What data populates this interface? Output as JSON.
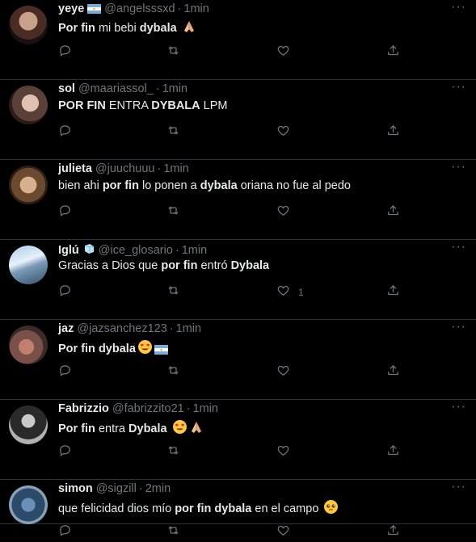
{
  "colors": {
    "background": "#000000",
    "divider": "#2f3336",
    "text": "#e7e9ea",
    "muted": "#71767b"
  },
  "tweets": [
    {
      "name": "yeye",
      "name_emoji": "argentina-flag",
      "handle": "@angelsssxd",
      "time": "1min",
      "segments": [
        {
          "t": "Por fin",
          "b": true
        },
        {
          "t": " mi bebi ",
          "b": false
        },
        {
          "t": "dybala",
          "b": true
        },
        {
          "t": " ",
          "b": false
        }
      ],
      "trailing_emojis": [
        "folded-hands"
      ],
      "like_count": ""
    },
    {
      "name": "sol",
      "handle": "@maariassol_",
      "time": "1min",
      "segments": [
        {
          "t": "POR FIN",
          "b": true
        },
        {
          "t": " ENTRA ",
          "b": false
        },
        {
          "t": "DYBALA",
          "b": true
        },
        {
          "t": " LPM",
          "b": false
        }
      ],
      "trailing_emojis": [],
      "like_count": ""
    },
    {
      "name": "julieta",
      "handle": "@juuchuuu",
      "time": "1min",
      "segments": [
        {
          "t": "bien ahi ",
          "b": false
        },
        {
          "t": "por fin",
          "b": true
        },
        {
          "t": " lo ponen a ",
          "b": false
        },
        {
          "t": "dybala",
          "b": true
        },
        {
          "t": " oriana no fue al pedo",
          "b": false
        }
      ],
      "trailing_emojis": [],
      "like_count": ""
    },
    {
      "name": "Iglú",
      "name_emoji": "ice-cube",
      "handle": "@ice_glosario",
      "time": "1min",
      "segments": [
        {
          "t": "Gracias a Dios que ",
          "b": false
        },
        {
          "t": "por fin",
          "b": true
        },
        {
          "t": " entró ",
          "b": false
        },
        {
          "t": "Dybala",
          "b": true
        }
      ],
      "trailing_emojis": [],
      "like_count": "1"
    },
    {
      "name": "jaz",
      "handle": "@jazsanchez123",
      "time": "1min",
      "segments": [
        {
          "t": "Por fin dybala",
          "b": true
        }
      ],
      "trailing_emojis": [
        "heart-eyes",
        "argentina-flag"
      ],
      "like_count": ""
    },
    {
      "name": "Fabrizzio",
      "handle": "@fabrizzito21",
      "time": "1min",
      "segments": [
        {
          "t": "Por fin",
          "b": true
        },
        {
          "t": " entra ",
          "b": false
        },
        {
          "t": "Dybala",
          "b": true
        },
        {
          "t": " ",
          "b": false
        }
      ],
      "trailing_emojis": [
        "heart-eyes",
        "folded-hands"
      ],
      "like_count": ""
    },
    {
      "name": "simon",
      "handle": "@sigzill",
      "time": "2min",
      "segments": [
        {
          "t": "que felicidad dios mío ",
          "b": false
        },
        {
          "t": "por fin dybala",
          "b": true
        },
        {
          "t": " en el campo ",
          "b": false
        }
      ],
      "trailing_emojis": [
        "pleading-face"
      ],
      "like_count": ""
    }
  ]
}
